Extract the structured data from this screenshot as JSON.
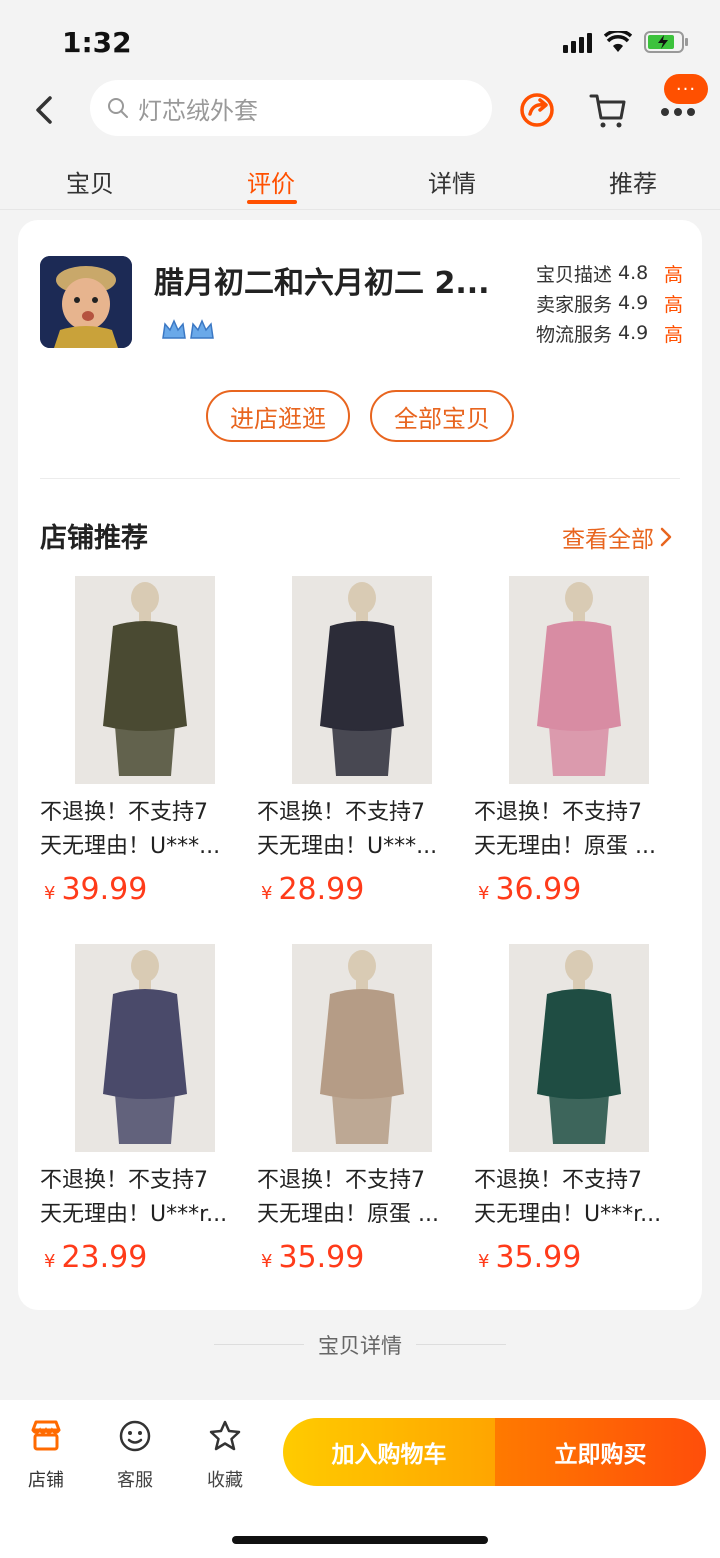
{
  "status_bar": {
    "time": "1:32"
  },
  "nav": {
    "search_placeholder": "灯芯绒外套",
    "more_badge": "···"
  },
  "tabs": [
    {
      "label": "宝贝",
      "active": false
    },
    {
      "label": "评价",
      "active": true
    },
    {
      "label": "详情",
      "active": false
    },
    {
      "label": "推荐",
      "active": false
    }
  ],
  "store": {
    "name": "腊月初二和六月初二 2...",
    "ratings": [
      {
        "label": "宝贝描述",
        "value": "4.8",
        "level": "高"
      },
      {
        "label": "卖家服务",
        "value": "4.9",
        "level": "高"
      },
      {
        "label": "物流服务",
        "value": "4.9",
        "level": "高"
      }
    ],
    "enter_store_label": "进店逛逛",
    "all_items_label": "全部宝贝"
  },
  "recommend": {
    "title": "店铺推荐",
    "view_all": "查看全部",
    "products": [
      {
        "line1": "不退换！不支持7",
        "line2": "天无理由！U***...",
        "currency": "¥",
        "price": "39.99",
        "color": "#4a4a32"
      },
      {
        "line1": "不退换！不支持7",
        "line2": "天无理由！U***...",
        "currency": "¥",
        "price": "28.99",
        "color": "#2c2c38"
      },
      {
        "line1": "不退换！不支持7",
        "line2": "天无理由！原蛋 ...",
        "currency": "¥",
        "price": "36.99",
        "color": "#d88ca3"
      },
      {
        "line1": "不退换！不支持7",
        "line2": "天无理由！U***r...",
        "currency": "¥",
        "price": "23.99",
        "color": "#4a4a6a"
      },
      {
        "line1": "不退换！不支持7",
        "line2": "天无理由！原蛋 ...",
        "currency": "¥",
        "price": "35.99",
        "color": "#b59c86"
      },
      {
        "line1": "不退换！不支持7",
        "line2": "天无理由！U***r...",
        "currency": "¥",
        "price": "35.99",
        "color": "#1f4d43"
      }
    ]
  },
  "details_label": "宝贝详情",
  "bottom_bar": {
    "store_label": "店铺",
    "service_label": "客服",
    "favorite_label": "收藏",
    "add_cart_label": "加入购物车",
    "buy_now_label": "立即购买"
  },
  "colors": {
    "accent": "#ff5000",
    "price": "#ff3b1a"
  }
}
